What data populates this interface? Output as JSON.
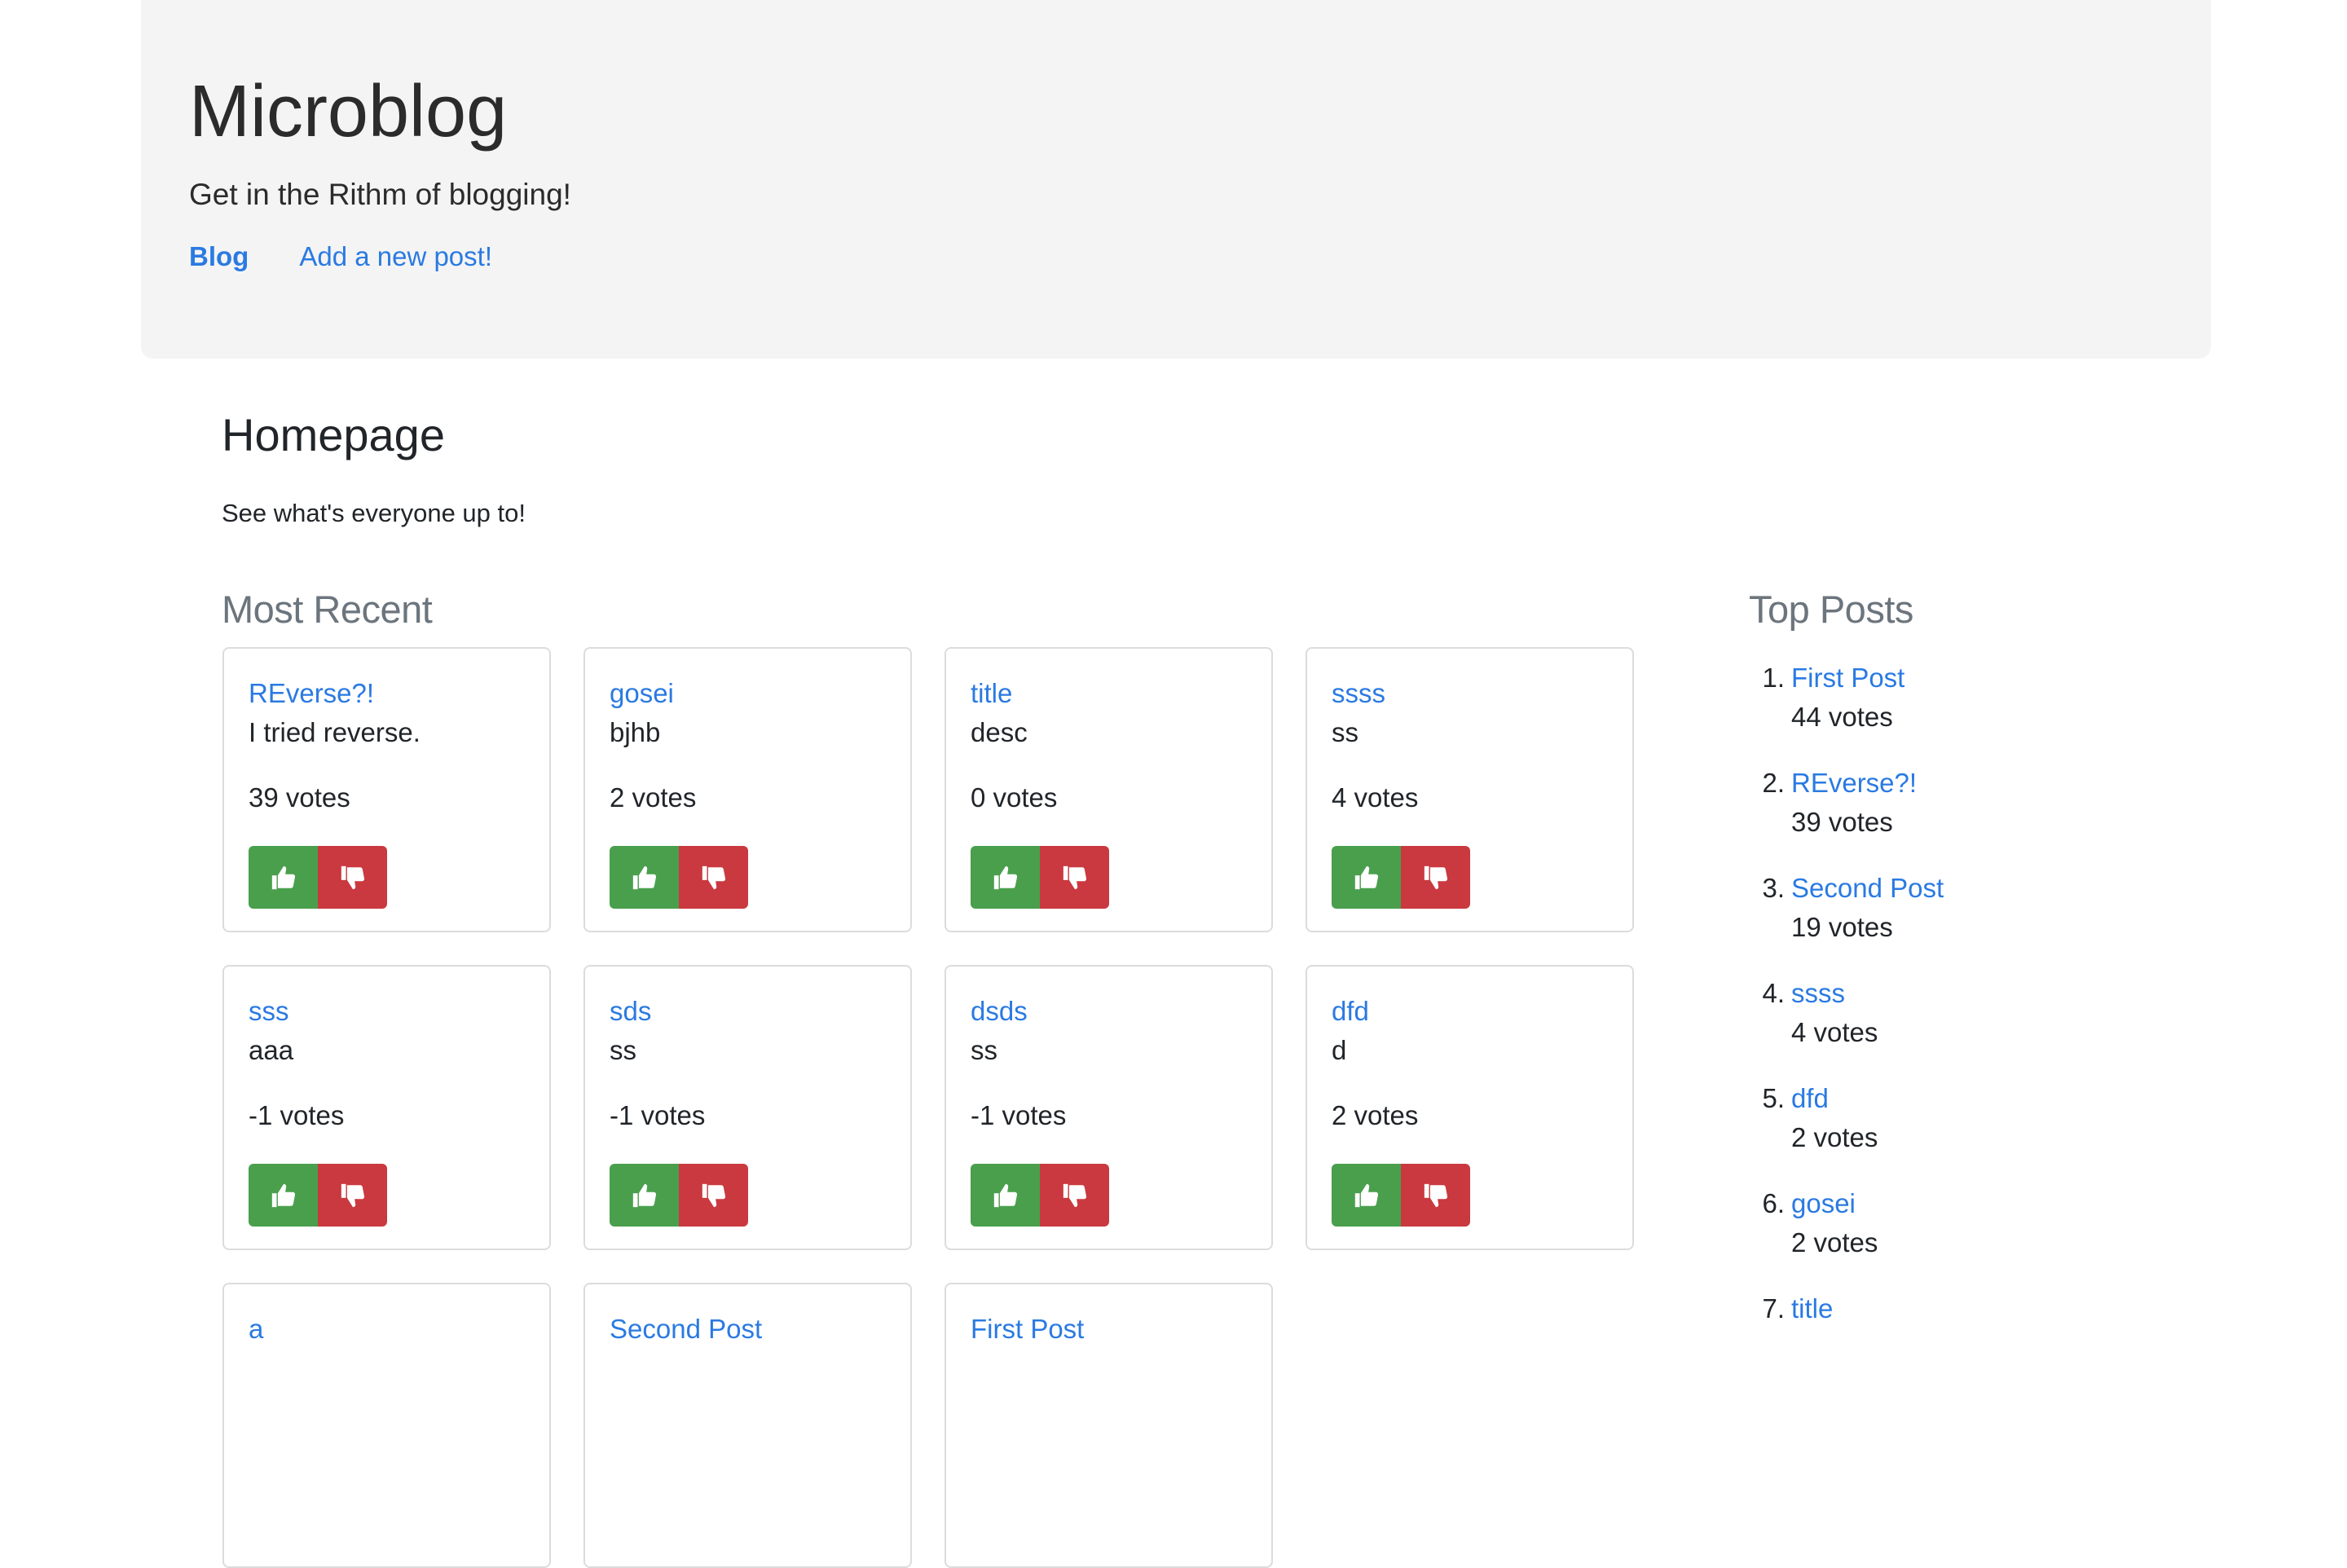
{
  "header": {
    "title": "Microblog",
    "tagline": "Get in the Rithm of blogging!",
    "nav": [
      {
        "label": "Blog",
        "active": true
      },
      {
        "label": "Add a new post!",
        "active": false
      }
    ]
  },
  "main": {
    "title": "Homepage",
    "subtitle": "See what's everyone up to!"
  },
  "recent": {
    "heading": "Most Recent",
    "posts": [
      {
        "title": "REverse?!",
        "description": "I tried reverse.",
        "votes": "39 votes"
      },
      {
        "title": "gosei",
        "description": "bjhb",
        "votes": "2 votes"
      },
      {
        "title": "title",
        "description": "desc",
        "votes": "0 votes"
      },
      {
        "title": "ssss",
        "description": "ss",
        "votes": "4 votes"
      },
      {
        "title": "sss",
        "description": "aaa",
        "votes": "-1 votes"
      },
      {
        "title": "sds",
        "description": "ss",
        "votes": "-1 votes"
      },
      {
        "title": "dsds",
        "description": "ss",
        "votes": "-1 votes"
      },
      {
        "title": "dfd",
        "description": "d",
        "votes": "2 votes"
      },
      {
        "title": "a",
        "description": "",
        "votes": ""
      },
      {
        "title": "Second Post",
        "description": "",
        "votes": ""
      },
      {
        "title": "First Post",
        "description": "",
        "votes": ""
      }
    ]
  },
  "top": {
    "heading": "Top Posts",
    "posts": [
      {
        "rank": "1.",
        "title": "First Post",
        "votes": "44 votes"
      },
      {
        "rank": "2.",
        "title": "REverse?!",
        "votes": "39 votes"
      },
      {
        "rank": "3.",
        "title": "Second Post",
        "votes": "19 votes"
      },
      {
        "rank": "4.",
        "title": "ssss",
        "votes": "4 votes"
      },
      {
        "rank": "5.",
        "title": "dfd",
        "votes": "2 votes"
      },
      {
        "rank": "6.",
        "title": "gosei",
        "votes": "2 votes"
      },
      {
        "rank": "7.",
        "title": "title",
        "votes": ""
      }
    ]
  },
  "icons": {
    "upvote": "thumbs-up-icon",
    "downvote": "thumbs-down-icon"
  },
  "colors": {
    "link": "#2a7ae2",
    "upvote": "#4a9f4d",
    "downvote": "#c9393f",
    "jumbotron": "#f4f4f4"
  }
}
